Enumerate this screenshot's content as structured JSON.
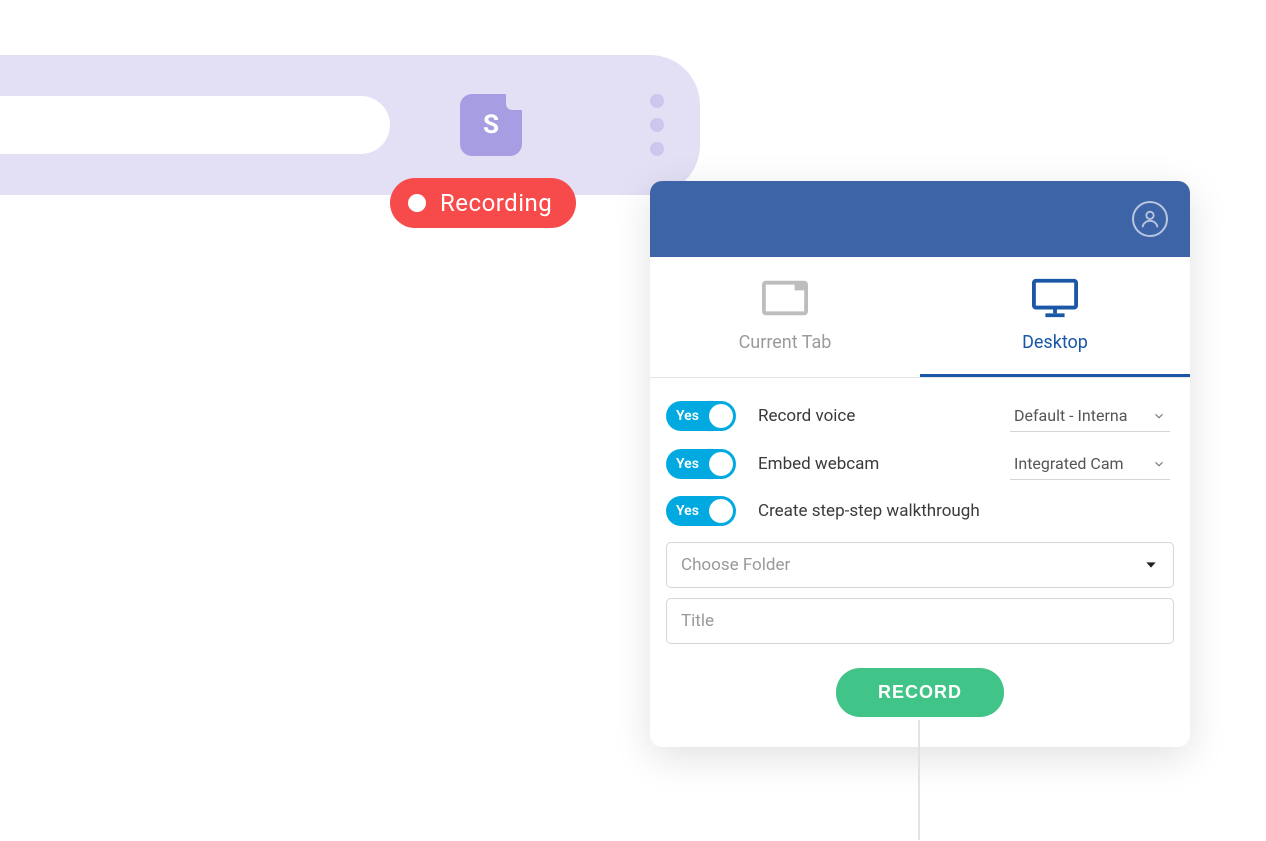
{
  "browser": {
    "ext_letter": "S"
  },
  "recording": {
    "label": "Recording"
  },
  "panel": {
    "tabs": {
      "current": "Current Tab",
      "desktop": "Desktop"
    },
    "toggles": {
      "yes": "Yes"
    },
    "options": {
      "record_voice": "Record voice",
      "embed_webcam": "Embed webcam",
      "walkthrough": "Create step-step walkthrough"
    },
    "selects": {
      "audio": "Default - Interna",
      "camera": "Integrated Cam"
    },
    "fields": {
      "folder_placeholder": "Choose Folder",
      "title_placeholder": "Title"
    },
    "record_button": "RECORD"
  }
}
